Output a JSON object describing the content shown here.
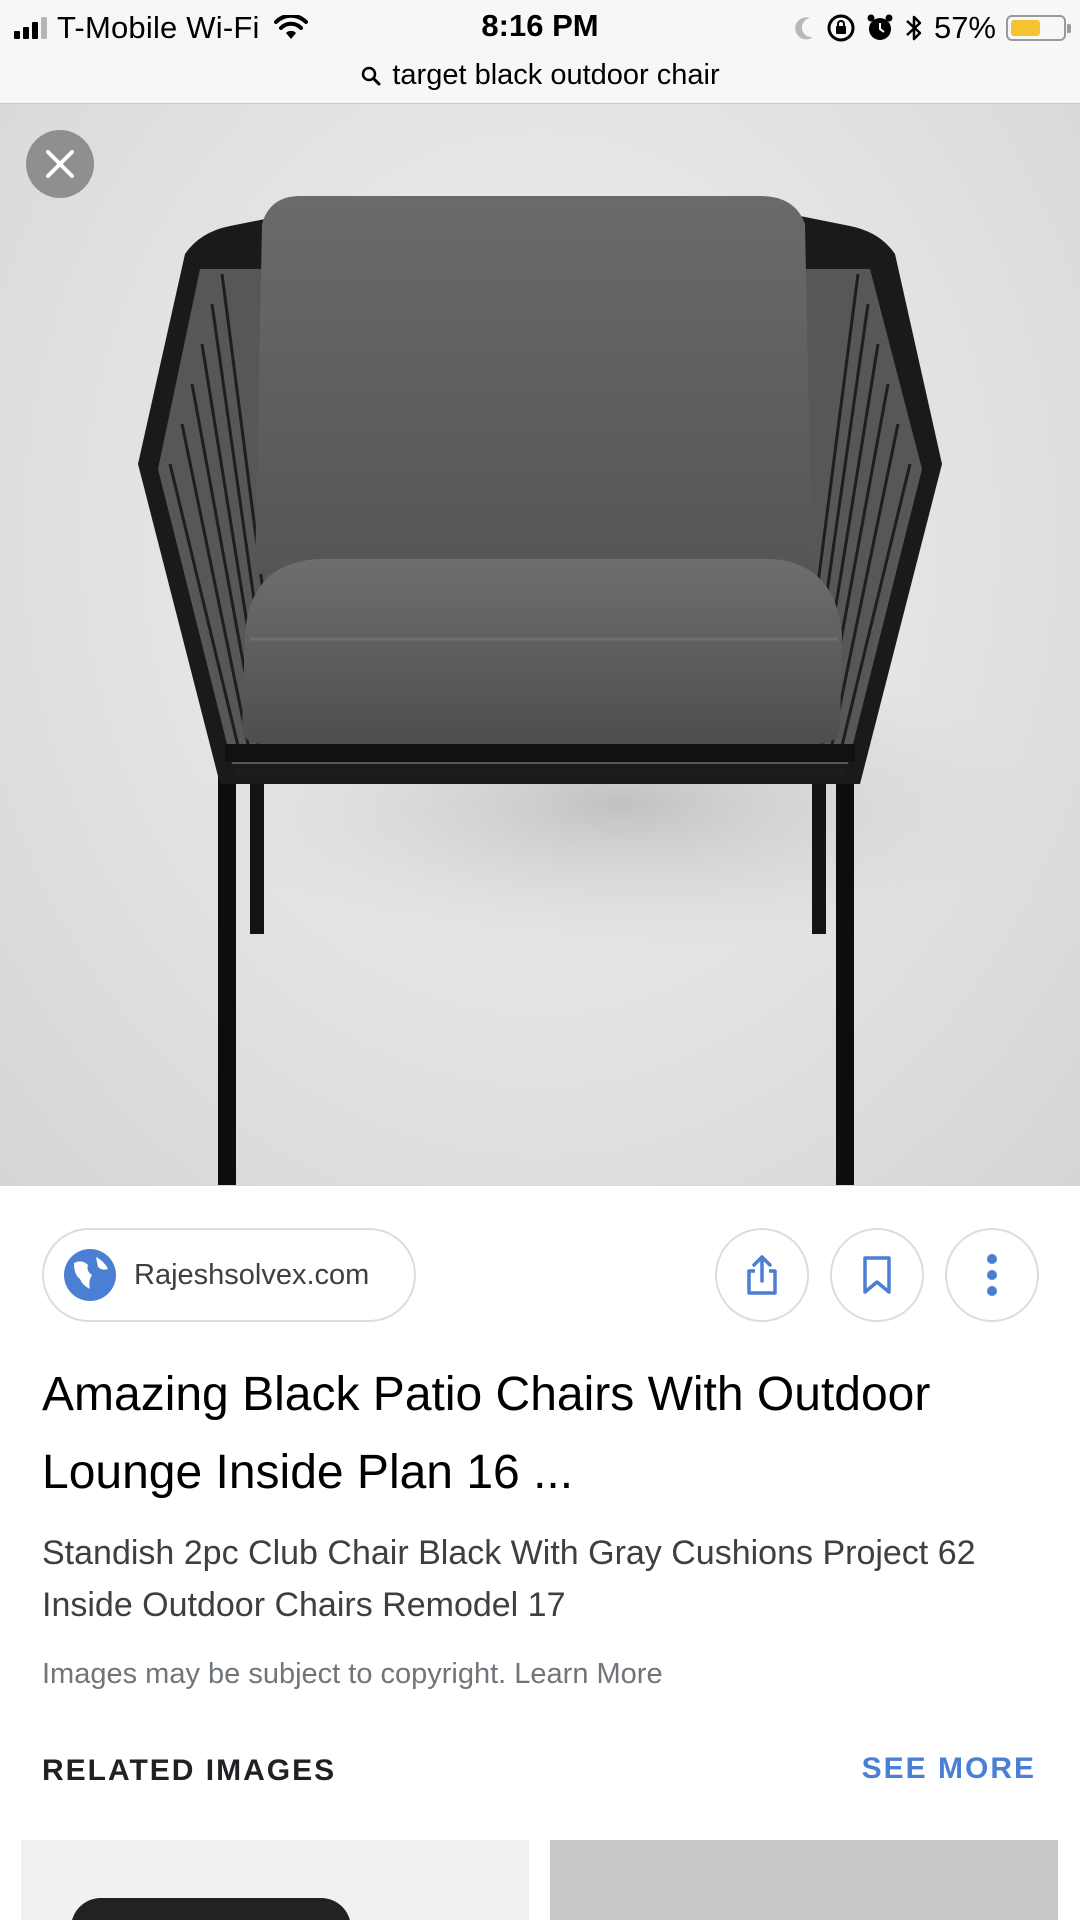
{
  "status_bar": {
    "carrier": "T-Mobile Wi-Fi",
    "time": "8:16 PM",
    "battery": "57%",
    "battery_level": 0.57,
    "icons": [
      "signal-icon",
      "wifi-icon",
      "moon-icon",
      "rotation-lock-icon",
      "alarm-icon",
      "bluetooth-icon",
      "battery-icon"
    ]
  },
  "url_bar": {
    "query": "target black outdoor chair"
  },
  "image_viewer": {
    "close_icon": "close-icon",
    "image_subject": "chair-photo"
  },
  "source": {
    "label": "Rajeshsolvex.com",
    "icon": "globe-icon"
  },
  "actions": {
    "share_icon": "share-icon",
    "bookmark_icon": "bookmark-icon",
    "more_icon": "more-vert-icon"
  },
  "result": {
    "title": "Amazing Black Patio Chairs With Outdoor Lounge Inside Plan 16 ...",
    "description": "Standish 2pc Club Chair Black With Gray Cushions Project 62 Inside Outdoor Chairs Remodel 17",
    "copyright": "Images may be subject to copyright. Learn More"
  },
  "related": {
    "header": "RELATED IMAGES",
    "see_more": "SEE MORE"
  },
  "colors": {
    "accent": "#4a7fd4",
    "battery": "#f5c330",
    "close_button": "#8f8f8f"
  }
}
